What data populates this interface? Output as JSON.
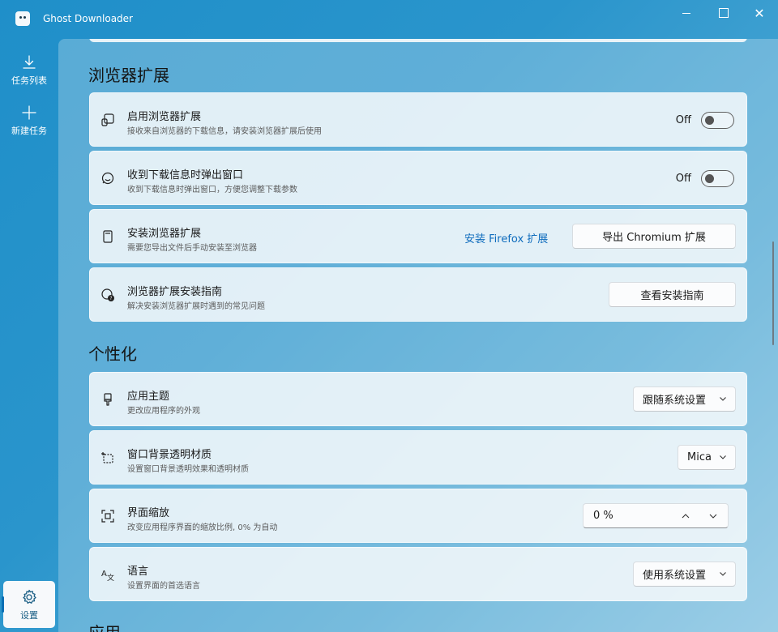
{
  "app": {
    "title": "Ghost Downloader"
  },
  "window": {
    "minimize": "—",
    "maximize": "☐",
    "close": "✕"
  },
  "nav": {
    "tasks": "任务列表",
    "new_task": "新建任务",
    "settings": "设置"
  },
  "sections": {
    "browser_ext": "浏览器扩展",
    "personalize": "个性化",
    "application": "应用"
  },
  "browser": {
    "enable": {
      "title": "启用浏览器扩展",
      "desc": "接收来自浏览器的下载信息，请安装浏览器扩展后使用",
      "state": "Off"
    },
    "popup": {
      "title": "收到下载信息时弹出窗口",
      "desc": "收到下载信息时弹出窗口，方便您调整下载参数",
      "state": "Off"
    },
    "install": {
      "title": "安装浏览器扩展",
      "desc": "需要您导出文件后手动安装至浏览器",
      "firefox_link": "安装 Firefox 扩展",
      "chromium_button": "导出 Chromium 扩展"
    },
    "guide": {
      "title": "浏览器扩展安装指南",
      "desc": "解决安装浏览器扩展时遇到的常见问题",
      "button": "查看安装指南"
    }
  },
  "personal": {
    "theme": {
      "title": "应用主题",
      "desc": "更改应用程序的外观",
      "value": "跟随系统设置"
    },
    "material": {
      "title": "窗口背景透明材质",
      "desc": "设置窗口背景透明效果和透明材质",
      "value": "Mica"
    },
    "zoom": {
      "title": "界面缩放",
      "desc": "改变应用程序界面的缩放比例, 0% 为自动",
      "value": "0 %"
    },
    "language": {
      "title": "语言",
      "desc": "设置界面的首选语言",
      "value": "使用系统设置"
    }
  }
}
